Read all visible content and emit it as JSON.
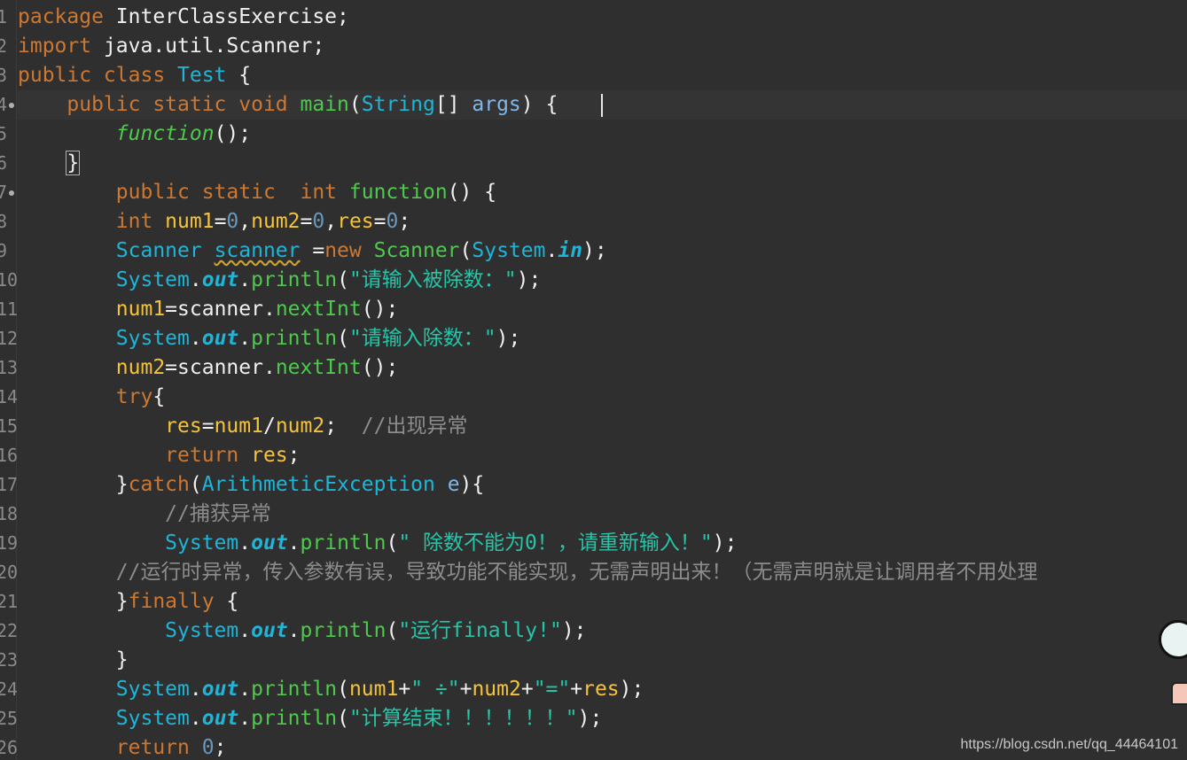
{
  "editor": {
    "line_numbers": [
      "1",
      "2",
      "3",
      "4",
      "5",
      "6",
      "7",
      "8",
      "9",
      "10",
      "11",
      "12",
      "13",
      "14",
      "15",
      "16",
      "17",
      "18",
      "19",
      "20",
      "21",
      "22",
      "23",
      "24",
      "25",
      "26"
    ],
    "lines": [
      [
        [
          "kw",
          "package "
        ],
        [
          "pl",
          "InterClassExercise;"
        ]
      ],
      [
        [
          "kw",
          "import "
        ],
        [
          "pl",
          "java.util.Scanner;"
        ]
      ],
      [
        [
          "kw",
          "public class "
        ],
        [
          "tp",
          "Test"
        ],
        [
          "pl",
          " {"
        ]
      ],
      [
        [
          "pl",
          "    "
        ],
        [
          "kw",
          "public static void "
        ],
        [
          "fn",
          "main"
        ],
        [
          "pl",
          "("
        ],
        [
          "tp",
          "String"
        ],
        [
          "pl",
          "[] "
        ],
        [
          "par",
          "args"
        ],
        [
          "pl",
          ") {"
        ]
      ],
      [
        [
          "pl",
          "        "
        ],
        [
          "fni",
          "function"
        ],
        [
          "pl",
          "();"
        ]
      ],
      [
        [
          "pl",
          "    "
        ],
        [
          "brace",
          "}"
        ]
      ],
      [
        [
          "pl",
          "        "
        ],
        [
          "kw",
          "public static  int "
        ],
        [
          "fn",
          "function"
        ],
        [
          "pl",
          "() {"
        ]
      ],
      [
        [
          "pl",
          "        "
        ],
        [
          "kw",
          "int "
        ],
        [
          "var",
          "num1"
        ],
        [
          "pl",
          "="
        ],
        [
          "num",
          "0"
        ],
        [
          "pl",
          ","
        ],
        [
          "var",
          "num2"
        ],
        [
          "pl",
          "="
        ],
        [
          "num",
          "0"
        ],
        [
          "pl",
          ","
        ],
        [
          "var",
          "res"
        ],
        [
          "pl",
          "="
        ],
        [
          "num",
          "0"
        ],
        [
          "pl",
          ";"
        ]
      ],
      [
        [
          "pl",
          "        "
        ],
        [
          "tp",
          "Scanner "
        ],
        [
          "squig",
          "scanner"
        ],
        [
          "pl",
          " ="
        ],
        [
          "kw",
          "new "
        ],
        [
          "fn",
          "Scanner"
        ],
        [
          "pl",
          "("
        ],
        [
          "tp",
          "System"
        ],
        [
          "pl",
          "."
        ],
        [
          "st",
          "in"
        ],
        [
          "pl",
          ");"
        ]
      ],
      [
        [
          "pl",
          "        "
        ],
        [
          "tp",
          "System"
        ],
        [
          "pl",
          "."
        ],
        [
          "st",
          "out"
        ],
        [
          "pl",
          "."
        ],
        [
          "fn",
          "println"
        ],
        [
          "pl",
          "("
        ],
        [
          "str",
          "\"请输入被除数：\""
        ],
        [
          "pl",
          ");"
        ]
      ],
      [
        [
          "pl",
          "        "
        ],
        [
          "var",
          "num1"
        ],
        [
          "pl",
          "="
        ],
        [
          "pl",
          "scanner."
        ],
        [
          "fn",
          "nextInt"
        ],
        [
          "pl",
          "();"
        ]
      ],
      [
        [
          "pl",
          "        "
        ],
        [
          "tp",
          "System"
        ],
        [
          "pl",
          "."
        ],
        [
          "st",
          "out"
        ],
        [
          "pl",
          "."
        ],
        [
          "fn",
          "println"
        ],
        [
          "pl",
          "("
        ],
        [
          "str",
          "\"请输入除数：\""
        ],
        [
          "pl",
          ");"
        ]
      ],
      [
        [
          "pl",
          "        "
        ],
        [
          "var",
          "num2"
        ],
        [
          "pl",
          "="
        ],
        [
          "pl",
          "scanner."
        ],
        [
          "fn",
          "nextInt"
        ],
        [
          "pl",
          "();"
        ]
      ],
      [
        [
          "pl",
          "        "
        ],
        [
          "kw",
          "try"
        ],
        [
          "pl",
          "{"
        ]
      ],
      [
        [
          "pl",
          "            "
        ],
        [
          "var",
          "res"
        ],
        [
          "pl",
          "="
        ],
        [
          "var",
          "num1"
        ],
        [
          "pl",
          "/"
        ],
        [
          "var",
          "num2"
        ],
        [
          "pl",
          ";  "
        ],
        [
          "cm",
          "//出现异常"
        ]
      ],
      [
        [
          "pl",
          "            "
        ],
        [
          "kw",
          "return "
        ],
        [
          "var",
          "res"
        ],
        [
          "pl",
          ";"
        ]
      ],
      [
        [
          "pl",
          "        }"
        ],
        [
          "kw",
          "catch"
        ],
        [
          "pl",
          "("
        ],
        [
          "tp",
          "ArithmeticException "
        ],
        [
          "par",
          "e"
        ],
        [
          "pl",
          "){"
        ]
      ],
      [
        [
          "pl",
          "            "
        ],
        [
          "cm",
          "//捕获异常"
        ]
      ],
      [
        [
          "pl",
          "            "
        ],
        [
          "tp",
          "System"
        ],
        [
          "pl",
          "."
        ],
        [
          "st",
          "out"
        ],
        [
          "pl",
          "."
        ],
        [
          "fn",
          "println"
        ],
        [
          "pl",
          "("
        ],
        [
          "str",
          "\" 除数不能为0！，请重新输入！\""
        ],
        [
          "pl",
          ");"
        ]
      ],
      [
        [
          "pl",
          "        "
        ],
        [
          "cm",
          "//运行时异常，传入参数有误，导致功能不能实现，无需声明出来！（无需声明就是让调用者不用处理"
        ]
      ],
      [
        [
          "pl",
          "        }"
        ],
        [
          "kw",
          "finally "
        ],
        [
          "pl",
          "{"
        ]
      ],
      [
        [
          "pl",
          "            "
        ],
        [
          "tp",
          "System"
        ],
        [
          "pl",
          "."
        ],
        [
          "st",
          "out"
        ],
        [
          "pl",
          "."
        ],
        [
          "fn",
          "println"
        ],
        [
          "pl",
          "("
        ],
        [
          "str",
          "\"运行finally!\""
        ],
        [
          "pl",
          ");"
        ]
      ],
      [
        [
          "pl",
          "        }"
        ]
      ],
      [
        [
          "pl",
          "        "
        ],
        [
          "tp",
          "System"
        ],
        [
          "pl",
          "."
        ],
        [
          "st",
          "out"
        ],
        [
          "pl",
          "."
        ],
        [
          "fn",
          "println"
        ],
        [
          "pl",
          "("
        ],
        [
          "var",
          "num1"
        ],
        [
          "pl",
          "+"
        ],
        [
          "str",
          "\" ÷\""
        ],
        [
          "pl",
          "+"
        ],
        [
          "var",
          "num2"
        ],
        [
          "pl",
          "+"
        ],
        [
          "str",
          "\"=\""
        ],
        [
          "pl",
          "+"
        ],
        [
          "var",
          "res"
        ],
        [
          "pl",
          ");"
        ]
      ],
      [
        [
          "pl",
          "        "
        ],
        [
          "tp",
          "System"
        ],
        [
          "pl",
          "."
        ],
        [
          "st",
          "out"
        ],
        [
          "pl",
          "."
        ],
        [
          "fn",
          "println"
        ],
        [
          "pl",
          "("
        ],
        [
          "str",
          "\"计算结束！！！！！！\""
        ],
        [
          "pl",
          ");"
        ]
      ],
      [
        [
          "pl",
          "        "
        ],
        [
          "kw",
          "return "
        ],
        [
          "num",
          "0"
        ],
        [
          "pl",
          ";"
        ]
      ]
    ]
  },
  "watermark": "https://blog.csdn.net/qq_44464101",
  "colors": {
    "background": "#2f2f2f",
    "keyword": "#cc7832",
    "type": "#1eb5d8",
    "method": "#4ec94e",
    "string": "#27c4a8",
    "comment": "#8c8c8c",
    "number": "#6897bb"
  }
}
